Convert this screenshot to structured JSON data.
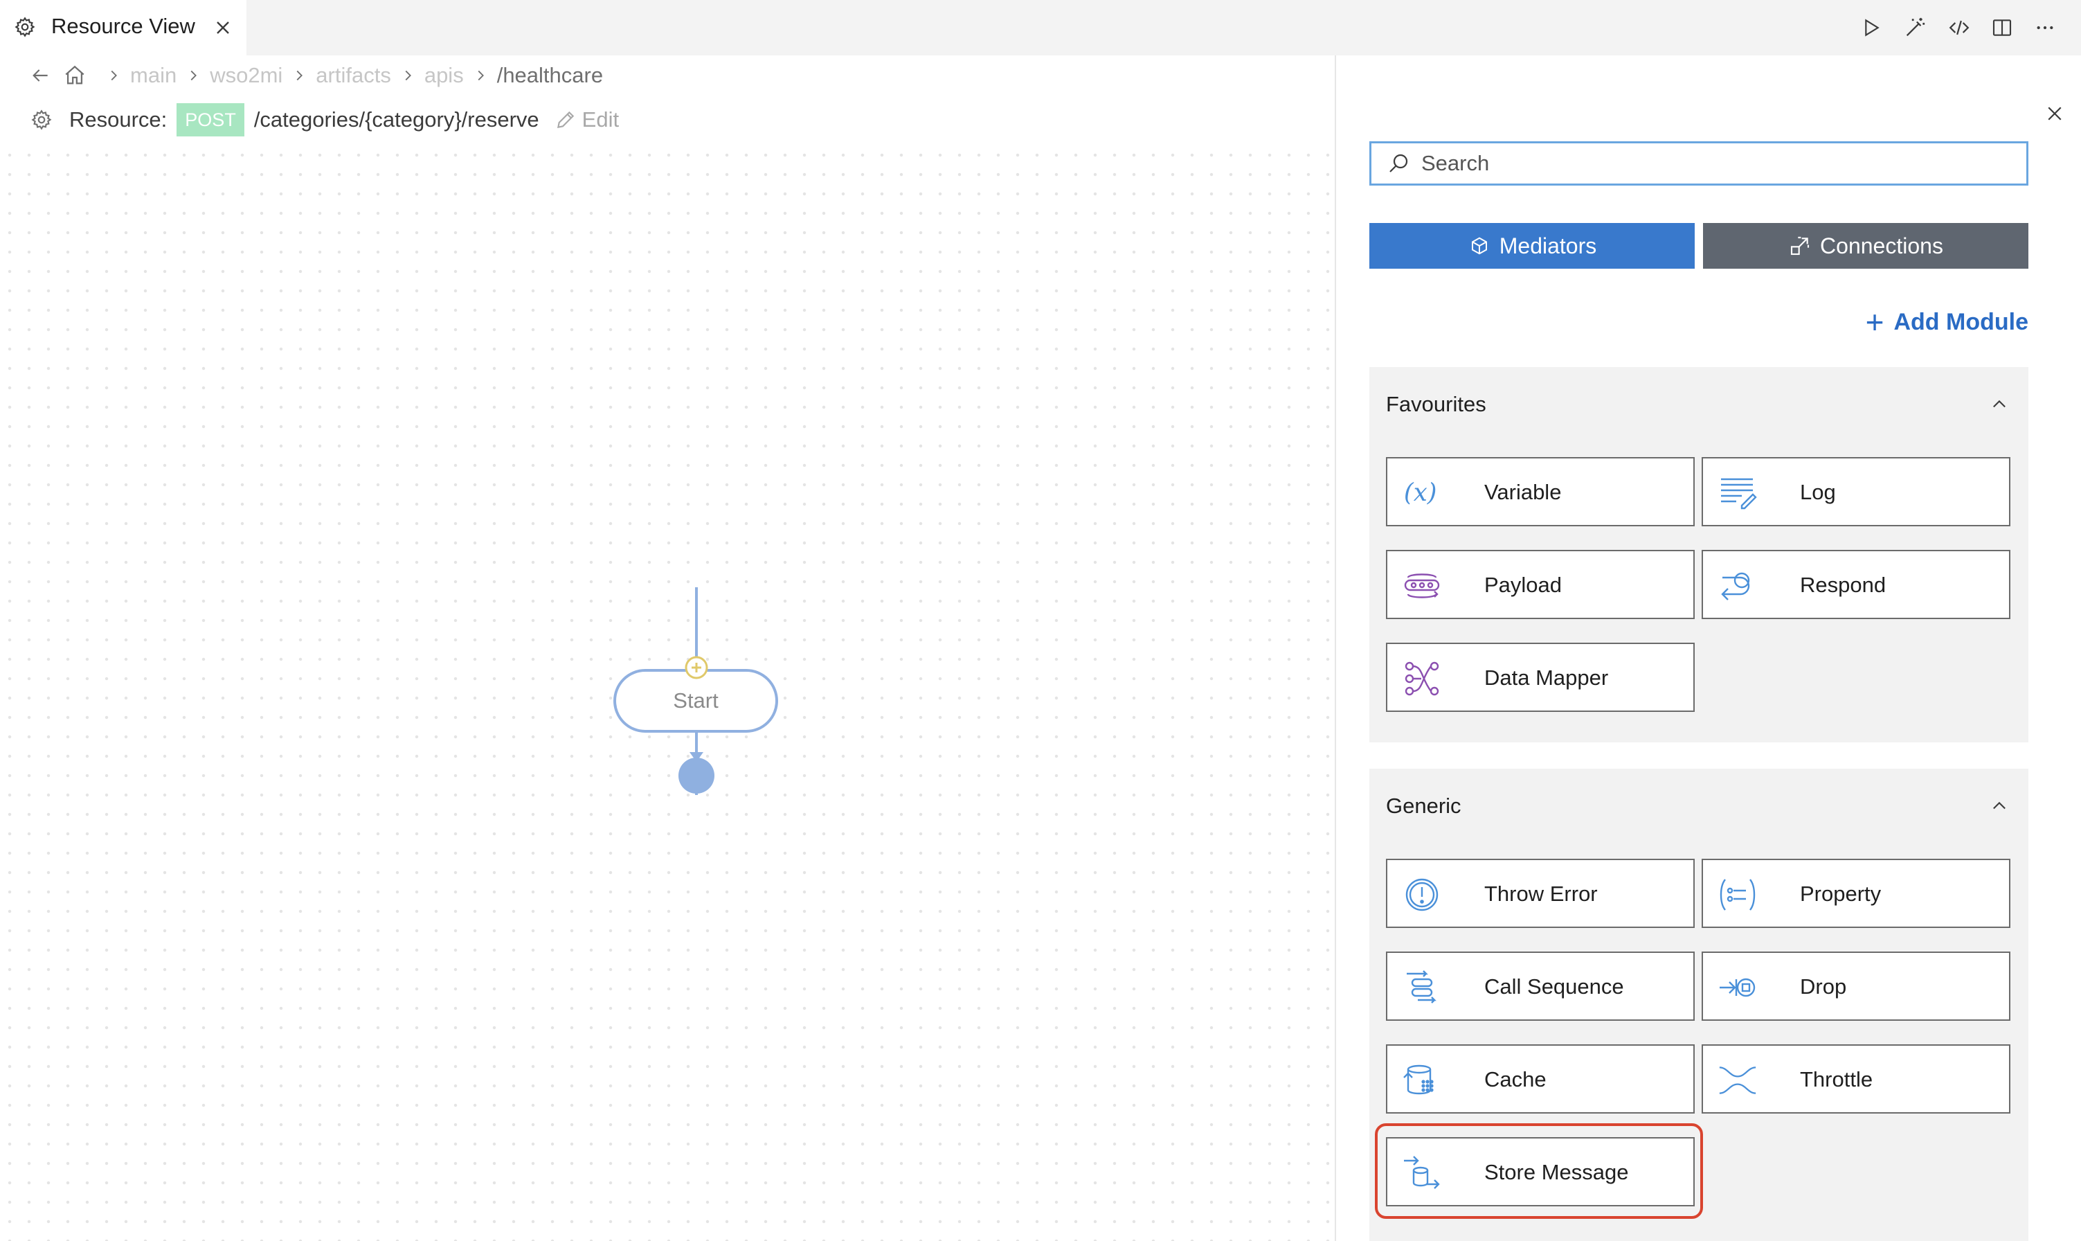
{
  "tab": {
    "title": "Resource View"
  },
  "toolbar": {
    "icons": [
      "run-icon",
      "magic-wand-icon",
      "code-icon",
      "split-editor-icon",
      "more-icon"
    ]
  },
  "breadcrumb": {
    "items": [
      "main",
      "wso2mi",
      "artifacts",
      "apis",
      "/healthcare"
    ]
  },
  "resource": {
    "label": "Resource:",
    "method": "POST",
    "path": "/categories/{category}/reserve",
    "edit_label": "Edit"
  },
  "canvas": {
    "start_label": "Start"
  },
  "panel": {
    "search_placeholder": "Search",
    "tabs": {
      "mediators": "Mediators",
      "connections": "Connections"
    },
    "add_module": "Add Module",
    "sections": [
      {
        "title": "Favourites",
        "items": [
          "Variable",
          "Log",
          "Payload",
          "Respond",
          "Data Mapper"
        ]
      },
      {
        "title": "Generic",
        "items": [
          "Throw Error",
          "Property",
          "Call Sequence",
          "Drop",
          "Cache",
          "Throttle",
          "Store Message"
        ]
      }
    ]
  },
  "colors": {
    "accent": "#3979cc",
    "connections_bg": "#5f6670",
    "method_badge": "#a8e6c1",
    "highlight": "#d9442f",
    "icon_blue": "#4a90d9",
    "icon_purple": "#8b4fb0"
  }
}
